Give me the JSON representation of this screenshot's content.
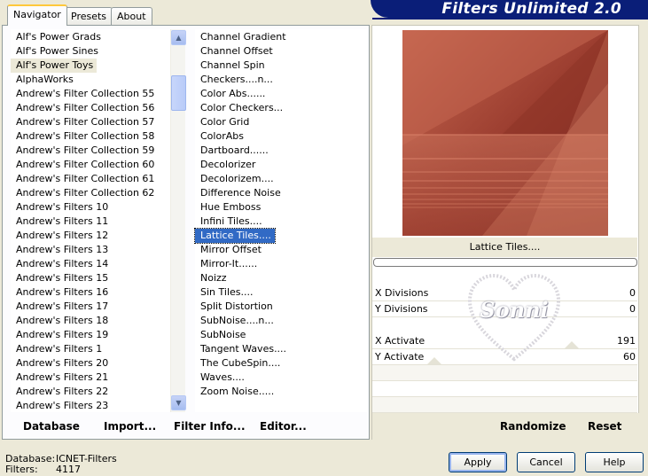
{
  "tabs": [
    {
      "label": "Navigator",
      "active": true
    },
    {
      "label": "Presets",
      "active": false
    },
    {
      "label": "About",
      "active": false
    }
  ],
  "banner_title": "Filters Unlimited 2.0",
  "categories": [
    "Alf's Power Grads",
    "Alf's Power Sines",
    "Alf's Power Toys",
    "AlphaWorks",
    "Andrew's Filter Collection 55",
    "Andrew's Filter Collection 56",
    "Andrew's Filter Collection 57",
    "Andrew's Filter Collection 58",
    "Andrew's Filter Collection 59",
    "Andrew's Filter Collection 60",
    "Andrew's Filter Collection 61",
    "Andrew's Filter Collection 62",
    "Andrew's Filters 10",
    "Andrew's Filters 11",
    "Andrew's Filters 12",
    "Andrew's Filters 13",
    "Andrew's Filters 14",
    "Andrew's Filters 15",
    "Andrew's Filters 16",
    "Andrew's Filters 17",
    "Andrew's Filters 18",
    "Andrew's Filters 19",
    "Andrew's Filters 1",
    "Andrew's Filters 20",
    "Andrew's Filters 21",
    "Andrew's Filters 22",
    "Andrew's Filters 23"
  ],
  "selected_category_index": 2,
  "filters": [
    "Channel Gradient",
    "Channel Offset",
    "Channel Spin",
    "Checkers....n...",
    "Color Abs......",
    "Color Checkers...",
    "Color Grid",
    "ColorAbs",
    "Dartboard......",
    "Decolorizer",
    "Decolorizem....",
    "Difference Noise",
    "Hue Emboss",
    "Infini Tiles....",
    "Lattice Tiles....",
    "Mirror Offset",
    "Mirror-It......",
    "Noizz",
    "Sin Tiles....",
    "Split Distortion",
    "SubNoise....n...",
    "SubNoise",
    "Tangent Waves....",
    "The CubeSpin....",
    "Waves....",
    "Zoom Noise....."
  ],
  "selected_filter_index": 14,
  "filter_title": "Lattice Tiles....",
  "params": [
    {
      "label": "X Divisions",
      "value": "0"
    },
    {
      "label": "Y Divisions",
      "value": "0"
    },
    {
      "label": "X Activate",
      "value": "191"
    },
    {
      "label": "Y Activate",
      "value": "60"
    }
  ],
  "watermark": "Sonni",
  "bottom_links": {
    "database": "Database",
    "import": "Import...",
    "filter_info": "Filter Info...",
    "editor": "Editor...",
    "randomize": "Randomize",
    "reset": "Reset"
  },
  "status": {
    "database_label": "Database:",
    "database_value": "ICNET-Filters",
    "filters_label": "Filters:",
    "filters_value": "4117"
  },
  "buttons": {
    "apply": "Apply",
    "cancel": "Cancel",
    "help": "Help"
  },
  "colors": {
    "selection": "#316ac5",
    "banner": "#0a1e78",
    "preview": "#a44a3a"
  }
}
